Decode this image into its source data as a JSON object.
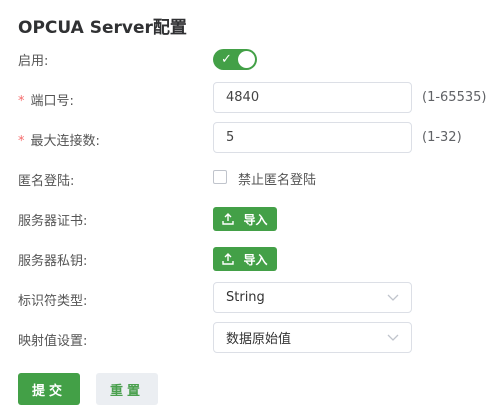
{
  "title": "OPCUA Server配置",
  "colors": {
    "accent": "#43a047",
    "required": "#f56c6c",
    "border": "#dcdfe6"
  },
  "enable": {
    "label": "启用:",
    "on": true
  },
  "port": {
    "required_mark": "*",
    "label": "端口号:",
    "value": "4840",
    "hint": "(1-65535)"
  },
  "max_conn": {
    "required_mark": "*",
    "label": "最大连接数:",
    "value": "5",
    "hint": "(1-32)"
  },
  "anonymous": {
    "label": "匿名登陆:",
    "checkbox_label": "禁止匿名登陆",
    "checked": false
  },
  "server_cert": {
    "label": "服务器证书:",
    "button": "导入",
    "icon": "upload-icon"
  },
  "server_key": {
    "label": "服务器私钥:",
    "button": "导入",
    "icon": "upload-icon"
  },
  "identifier_type": {
    "label": "标识符类型:",
    "value": "String",
    "icon": "chevron-down-icon"
  },
  "mapping": {
    "label": "映射值设置:",
    "value": "数据原始值",
    "icon": "chevron-down-icon"
  },
  "actions": {
    "submit": "提交",
    "reset": "重置"
  }
}
